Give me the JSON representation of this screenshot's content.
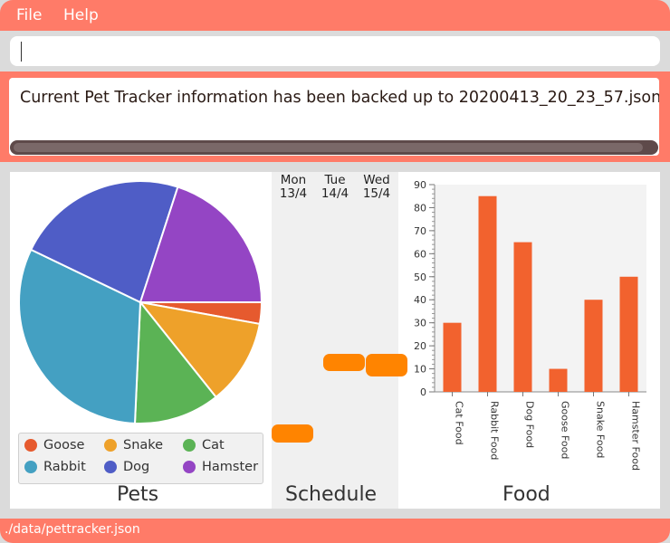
{
  "menu": {
    "file": "File",
    "help": "Help"
  },
  "command": {
    "value": "",
    "placeholder": ""
  },
  "result": {
    "message": "Current Pet Tracker information has been backed up to 20200413_20_23_57.json"
  },
  "pets": {
    "title": "Pets",
    "chart_data": {
      "type": "pie",
      "title": "Pets",
      "slices": [
        {
          "label": "Goose",
          "value": 1,
          "color": "#e65a2e"
        },
        {
          "label": "Snake",
          "value": 4,
          "color": "#eea12a"
        },
        {
          "label": "Cat",
          "value": 4,
          "color": "#5bb355"
        },
        {
          "label": "Rabbit",
          "value": 11,
          "color": "#44a0c2"
        },
        {
          "label": "Dog",
          "value": 8,
          "color": "#4f5dc6"
        },
        {
          "label": "Hamster",
          "value": 7,
          "color": "#9445c4"
        }
      ],
      "legend_position": "bottom"
    }
  },
  "schedule": {
    "title": "Schedule",
    "days": [
      {
        "name": "Mon",
        "date": "13/4"
      },
      {
        "name": "Tue",
        "date": "14/4"
      },
      {
        "name": "Wed",
        "date": "15/4"
      }
    ],
    "event_color": "#ff8400"
  },
  "food": {
    "title": "Food",
    "chart_data": {
      "type": "bar",
      "title": "Food",
      "categories": [
        "Cat Food",
        "Rabbit Food",
        "Dog Food",
        "Goose Food",
        "Snake Food",
        "Hamster Food"
      ],
      "values": [
        30,
        85,
        65,
        10,
        40,
        50
      ],
      "ylim": [
        0,
        90
      ],
      "yticks": [
        0,
        10,
        20,
        30,
        40,
        50,
        60,
        70,
        80,
        90
      ],
      "bar_color": "#f2622e",
      "xlabel": "",
      "ylabel": ""
    }
  },
  "status": {
    "path": "./data/pettracker.json"
  },
  "colors": {
    "accent": "#ff7b68",
    "content_bg": "#ffffff",
    "plot_bg": "#f3f3f3"
  }
}
